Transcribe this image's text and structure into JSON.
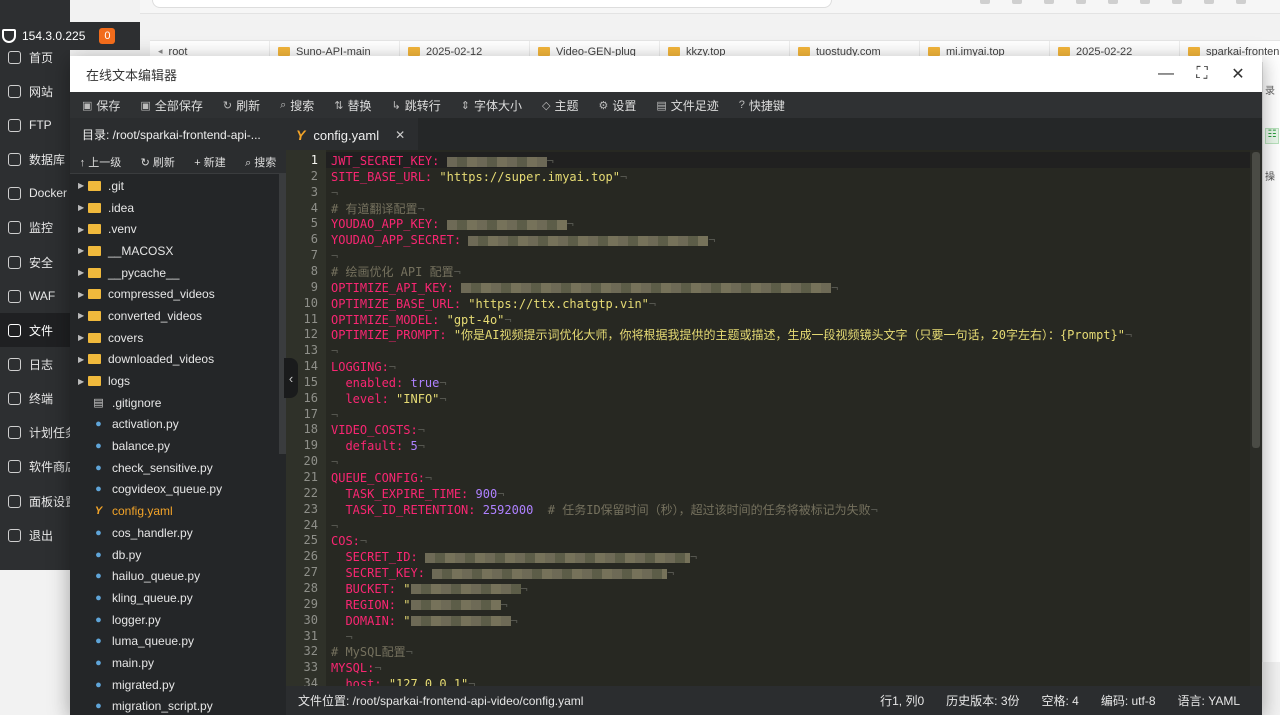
{
  "browser": {
    "bookmarks": [
      "root",
      "Suno-API-main",
      "2025-02-12",
      "Video-GEN-plug",
      "kkzy.top",
      "tuostudy.com",
      "mi.imyai.top",
      "2025-02-22",
      "sparkai-fronten"
    ]
  },
  "sidebar": {
    "server_ip": "154.3.0.225",
    "badge_count": "0",
    "items": [
      {
        "label": "首页",
        "icon": "home-icon"
      },
      {
        "label": "网站",
        "icon": "globe-icon"
      },
      {
        "label": "FTP",
        "icon": "ftp-icon"
      },
      {
        "label": "数据库",
        "icon": "database-icon"
      },
      {
        "label": "Docker",
        "icon": "docker-icon"
      },
      {
        "label": "监控",
        "icon": "monitor-icon"
      },
      {
        "label": "安全",
        "icon": "shield-icon"
      },
      {
        "label": "WAF",
        "icon": "waf-icon"
      },
      {
        "label": "文件",
        "icon": "folder-icon"
      },
      {
        "label": "日志",
        "icon": "log-icon"
      },
      {
        "label": "终端",
        "icon": "terminal-icon"
      },
      {
        "label": "计划任务",
        "icon": "calendar-icon"
      },
      {
        "label": "软件商店",
        "icon": "store-icon"
      },
      {
        "label": "面板设置",
        "icon": "gear-icon"
      },
      {
        "label": "退出",
        "icon": "logout-icon"
      }
    ]
  },
  "editor": {
    "title": "在线文本编辑器",
    "toolbar": [
      "保存",
      "全部保存",
      "刷新",
      "搜索",
      "替换",
      "跳转行",
      "字体大小",
      "主题",
      "设置",
      "文件足迹",
      "快捷键"
    ],
    "path_label": "目录: /root/sparkai-frontend-api-...",
    "tree_actions": [
      "上一级",
      "刷新",
      "新建",
      "搜索"
    ],
    "tree": [
      {
        "name": ".git",
        "type": "folder"
      },
      {
        "name": ".idea",
        "type": "folder"
      },
      {
        "name": ".venv",
        "type": "folder"
      },
      {
        "name": "__MACOSX",
        "type": "folder"
      },
      {
        "name": "__pycache__",
        "type": "folder"
      },
      {
        "name": "compressed_videos",
        "type": "folder"
      },
      {
        "name": "converted_videos",
        "type": "folder"
      },
      {
        "name": "covers",
        "type": "folder"
      },
      {
        "name": "downloaded_videos",
        "type": "folder"
      },
      {
        "name": "logs",
        "type": "folder"
      },
      {
        "name": ".gitignore",
        "type": "doc"
      },
      {
        "name": "activation.py",
        "type": "py"
      },
      {
        "name": "balance.py",
        "type": "py"
      },
      {
        "name": "check_sensitive.py",
        "type": "py"
      },
      {
        "name": "cogvideox_queue.py",
        "type": "py"
      },
      {
        "name": "config.yaml",
        "type": "yml",
        "active": true
      },
      {
        "name": "cos_handler.py",
        "type": "py"
      },
      {
        "name": "db.py",
        "type": "py"
      },
      {
        "name": "hailuo_queue.py",
        "type": "py"
      },
      {
        "name": "kling_queue.py",
        "type": "py"
      },
      {
        "name": "logger.py",
        "type": "py"
      },
      {
        "name": "luma_queue.py",
        "type": "py"
      },
      {
        "name": "main.py",
        "type": "py"
      },
      {
        "name": "migrated.py",
        "type": "py"
      },
      {
        "name": "migration_script.py",
        "type": "py"
      }
    ],
    "tab_name": "config.yaml",
    "code_lines": [
      [
        [
          "k",
          "JWT_SECRET_KEY:"
        ],
        [
          "t",
          " "
        ],
        [
          "b",
          100
        ]
      ],
      [
        [
          "k",
          "SITE_BASE_URL:"
        ],
        [
          "t",
          " "
        ],
        [
          "s",
          "\"https://super.imyai.top\""
        ]
      ],
      [],
      [
        [
          "c",
          "# 有道翻译配置"
        ]
      ],
      [
        [
          "k",
          "YOUDAO_APP_KEY:"
        ],
        [
          "t",
          " "
        ],
        [
          "b",
          120
        ]
      ],
      [
        [
          "k",
          "YOUDAO_APP_SECRET:"
        ],
        [
          "t",
          " "
        ],
        [
          "b",
          240
        ]
      ],
      [],
      [
        [
          "c",
          "# 绘画优化 API 配置"
        ]
      ],
      [
        [
          "k",
          "OPTIMIZE_API_KEY:"
        ],
        [
          "t",
          " "
        ],
        [
          "b",
          370
        ]
      ],
      [
        [
          "k",
          "OPTIMIZE_BASE_URL:"
        ],
        [
          "t",
          " "
        ],
        [
          "s",
          "\"https://ttx.chatgtp.vin\""
        ]
      ],
      [
        [
          "k",
          "OPTIMIZE_MODEL:"
        ],
        [
          "t",
          " "
        ],
        [
          "s",
          "\"gpt-4o\""
        ]
      ],
      [
        [
          "k",
          "OPTIMIZE_PROMPT:"
        ],
        [
          "t",
          " "
        ],
        [
          "s",
          "\"你是AI视频提示词优化大师，你将根据我提供的主题或描述，生成一段视频镜头文字（只要一句话，20字左右）：{Prompt}\""
        ]
      ],
      [],
      [
        [
          "k",
          "LOGGING:"
        ]
      ],
      [
        [
          "t",
          "  "
        ],
        [
          "k",
          "enabled:"
        ],
        [
          "t",
          " "
        ],
        [
          "n",
          "true"
        ]
      ],
      [
        [
          "t",
          "  "
        ],
        [
          "k",
          "level:"
        ],
        [
          "t",
          " "
        ],
        [
          "s",
          "\"INFO\""
        ]
      ],
      [],
      [
        [
          "k",
          "VIDEO_COSTS:"
        ]
      ],
      [
        [
          "t",
          "  "
        ],
        [
          "k",
          "default:"
        ],
        [
          "t",
          " "
        ],
        [
          "n",
          "5"
        ]
      ],
      [],
      [
        [
          "k",
          "QUEUE_CONFIG:"
        ]
      ],
      [
        [
          "t",
          "  "
        ],
        [
          "k",
          "TASK_EXPIRE_TIME:"
        ],
        [
          "t",
          " "
        ],
        [
          "n",
          "900"
        ]
      ],
      [
        [
          "t",
          "  "
        ],
        [
          "k",
          "TASK_ID_RETENTION:"
        ],
        [
          "t",
          " "
        ],
        [
          "n",
          "2592000"
        ],
        [
          "t",
          "  "
        ],
        [
          "c",
          "# 任务ID保留时间（秒），超过该时间的任务将被标记为失败"
        ]
      ],
      [],
      [
        [
          "k",
          "COS:"
        ]
      ],
      [
        [
          "t",
          "  "
        ],
        [
          "k",
          "SECRET_ID:"
        ],
        [
          "t",
          " "
        ],
        [
          "b",
          265
        ]
      ],
      [
        [
          "t",
          "  "
        ],
        [
          "k",
          "SECRET_KEY:"
        ],
        [
          "t",
          " "
        ],
        [
          "b",
          235
        ]
      ],
      [
        [
          "t",
          "  "
        ],
        [
          "k",
          "BUCKET:"
        ],
        [
          "t",
          " "
        ],
        [
          "s",
          "\""
        ],
        [
          "b",
          110
        ]
      ],
      [
        [
          "t",
          "  "
        ],
        [
          "k",
          "REGION:"
        ],
        [
          "t",
          " "
        ],
        [
          "s",
          "\""
        ],
        [
          "b",
          90
        ]
      ],
      [
        [
          "t",
          "  "
        ],
        [
          "k",
          "DOMAIN:"
        ],
        [
          "t",
          " "
        ],
        [
          "s",
          "\""
        ],
        [
          "b",
          100
        ]
      ],
      [
        [
          "t",
          "  "
        ]
      ],
      [
        [
          "c",
          "# MySQL配置"
        ]
      ],
      [
        [
          "k",
          "MYSQL:"
        ]
      ],
      [
        [
          "t",
          "  "
        ],
        [
          "k",
          "host:"
        ],
        [
          "t",
          " "
        ],
        [
          "s",
          "\"127.0.0.1\""
        ]
      ]
    ],
    "status": {
      "file_path": "文件位置: /root/sparkai-frontend-api-video/config.yaml",
      "cursor": "行1, 列0",
      "history": "历史版本: 3份",
      "indent": "空格: 4",
      "encoding": "编码: utf-8",
      "language": "语言: YAML"
    }
  },
  "right_fragment": {
    "text1": "录",
    "text2": "操"
  }
}
